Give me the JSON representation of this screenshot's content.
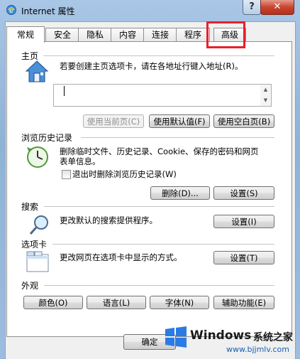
{
  "window": {
    "title": "Internet 属性",
    "help_label": "?",
    "close_label": "✕"
  },
  "tabs": [
    {
      "label": "常规",
      "active": true
    },
    {
      "label": "安全"
    },
    {
      "label": "隐私"
    },
    {
      "label": "内容"
    },
    {
      "label": "连接"
    },
    {
      "label": "程序"
    },
    {
      "label": "高级"
    }
  ],
  "home": {
    "title": "主页",
    "description": "若要创建主页选项卡，请在各地址行键入地址(R)。",
    "address_value": "",
    "use_current_label": "使用当前页(C)",
    "use_default_label": "使用默认值(F)",
    "use_blank_label": "使用空白页(B)"
  },
  "history": {
    "title": "浏览历史记录",
    "description_line1": "删除临时文件、历史记录、Cookie、保存的密码和网页",
    "description_line2": "表单信息。",
    "checkbox_label": "退出时删除浏览历史记录(W)",
    "checkbox_checked": false,
    "delete_label": "删除(D)...",
    "settings_label": "设置(S)"
  },
  "search": {
    "title": "搜索",
    "description": "更改默认的搜索提供程序。",
    "settings_label": "设置(I)"
  },
  "tabs_section": {
    "title": "选项卡",
    "description": "更改网页在选项卡中显示的方式。",
    "settings_label": "设置(T)"
  },
  "appearance": {
    "title": "外观",
    "colors_label": "颜色(O)",
    "languages_label": "语言(L)",
    "fonts_label": "字体(N)",
    "accessibility_label": "辅助功能(E)"
  },
  "footer": {
    "ok_label": "确定"
  },
  "watermark": {
    "brand": "Windows",
    "brand_cn": "系统之家",
    "url": "www.bjjmlv.com"
  },
  "colors": {
    "highlight": "#e8202a",
    "close": "#c8452f",
    "accent_url": "#1a5fb4"
  }
}
